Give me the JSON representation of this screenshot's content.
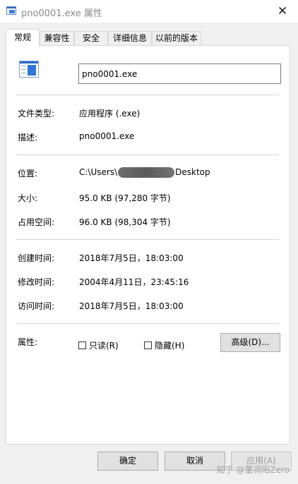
{
  "window": {
    "title": "pno0001.exe 属性",
    "close_glyph": "✕"
  },
  "tabs": [
    {
      "label": "常规",
      "active": true
    },
    {
      "label": "兼容性",
      "active": false
    },
    {
      "label": "安全",
      "active": false
    },
    {
      "label": "详细信息",
      "active": false
    },
    {
      "label": "以前的版本",
      "active": false
    }
  ],
  "general": {
    "file_name": "pno0001.exe",
    "type_label": "文件类型:",
    "type_value": "应用程序 (.exe)",
    "desc_label": "描述:",
    "desc_value": "pno0001.exe",
    "location_label": "位置:",
    "location_prefix": "C:\\Users\\",
    "location_suffix": "Desktop",
    "size_label": "大小:",
    "size_value": "95.0 KB (97,280 字节)",
    "disk_label": "占用空间:",
    "disk_value": "96.0 KB (98,304 字节)",
    "created_label": "创建时间:",
    "created_value": "2018年7月5日，18:03:00",
    "modified_label": "修改时间:",
    "modified_value": "2004年4月11日，23:45:16",
    "accessed_label": "访问时间:",
    "accessed_value": "2018年7月5日，18:03:00",
    "attr_label": "属性:",
    "readonly_label": "只读(R)",
    "readonly_checked": false,
    "hidden_label": "隐藏(H)",
    "hidden_checked": false,
    "advanced_label": "高级(D)..."
  },
  "footer": {
    "ok_label": "确定",
    "cancel_label": "取消",
    "apply_label": "应用(A)"
  },
  "watermark": "知乎 @董凋阳Zero",
  "colors": {
    "accent": "#2f78d8",
    "disabled_text": "#9c9c9c"
  }
}
